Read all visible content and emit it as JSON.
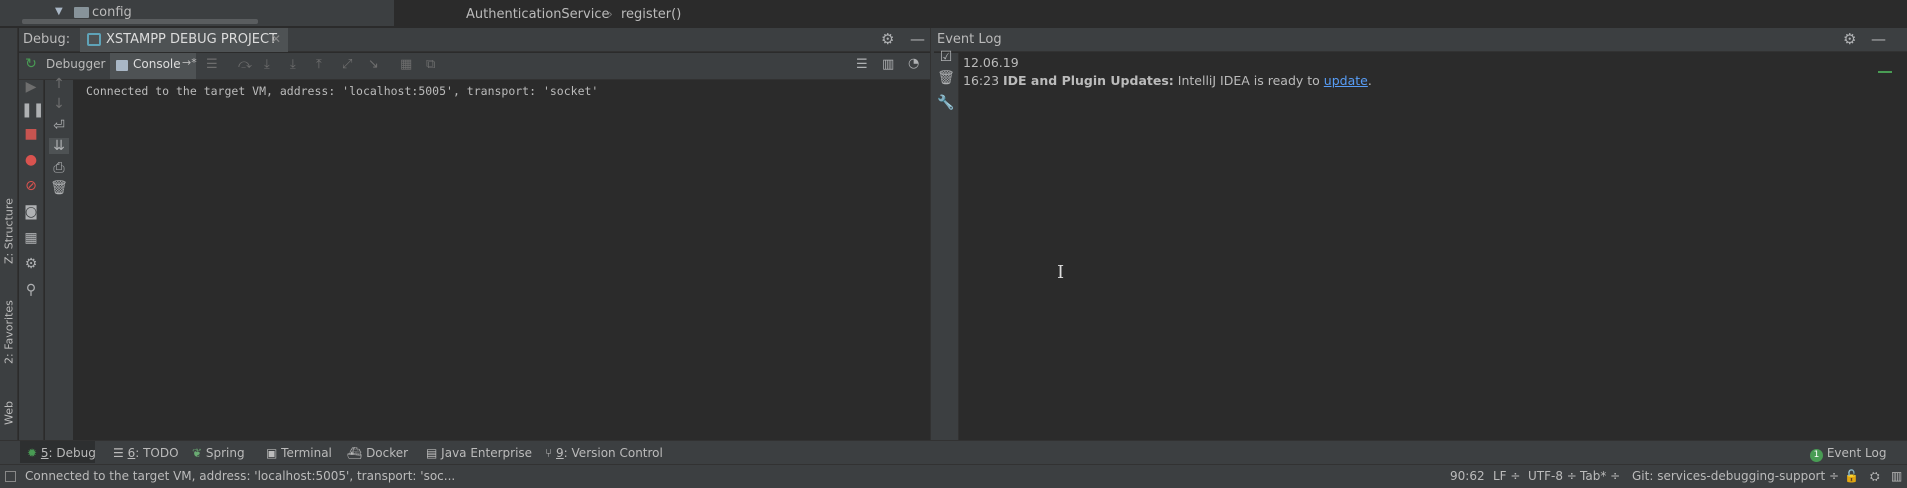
{
  "project_tree": {
    "node_label": "config",
    "expand_icon": "triangle-down",
    "folder_icon": "folder"
  },
  "breadcrumb": {
    "class_name": "AuthenticationService",
    "method_name": "register()",
    "separator": "›"
  },
  "left_stripe": {
    "structure": "Z: Structure",
    "favorites": "2: Favorites",
    "web": "Web"
  },
  "debug_panel": {
    "label": "Debug:",
    "session_tab": "XSTAMPP DEBUG PROJECT",
    "tabs": {
      "debugger": "Debugger",
      "console": "Console"
    },
    "console_lines": [
      "Connected to the target VM, address: 'localhost:5005', transport: 'socket'"
    ]
  },
  "event_log": {
    "title": "Event Log",
    "date": "12.06.19",
    "time": "16:23",
    "heading": "IDE and Plugin Updates:",
    "message": "IntelliJ IDEA is ready to",
    "link": "update",
    "suffix": "."
  },
  "tool_tabs": {
    "debug": {
      "num": "5",
      "label": ": Debug"
    },
    "todo": {
      "num": "6",
      "label": ": TODO"
    },
    "spring": "Spring",
    "terminal": "Terminal",
    "docker": "Docker",
    "java_enterprise": "Java Enterprise",
    "vcs": {
      "num": "9",
      "label": ": Version Control"
    },
    "event_log_badge": "1",
    "event_log": "Event Log"
  },
  "status_bar": {
    "message": "Connected to the target VM, address: 'localhost:5005', transport: 'soc...",
    "position": "90:62",
    "line_separator": "LF ÷",
    "encoding": "UTF-8 ÷",
    "indent": "Tab* ÷",
    "git_branch": "Git: services-debugging-support ÷"
  },
  "colors": {
    "panel_bg": "#3c3f41",
    "editor_bg": "#2b2b2b",
    "text": "#bbbbbb",
    "link": "#589df6",
    "stop_red": "#c75450",
    "resume_green": "#499c54",
    "breakpoint_red": "#d9534f"
  }
}
